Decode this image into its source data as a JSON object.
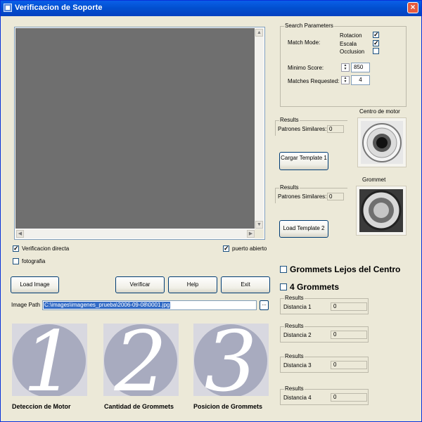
{
  "window": {
    "title": "Verificacion de Soporte",
    "close_glyph": "×"
  },
  "options": {
    "verificacion_directa": {
      "label": "Verificacion directa",
      "checked": true
    },
    "puerto_abierto": {
      "label": "puerto abierto",
      "checked": true
    },
    "fotografia": {
      "label": "fotografia",
      "checked": false
    }
  },
  "buttons": {
    "load_image": "Load Image",
    "verificar": "Verificar",
    "help": "Help",
    "exit": "Exit",
    "browse": "..."
  },
  "image_path": {
    "label": "Image Path",
    "value": "C:\\images\\imagenes_prueba\\2006-09-08\\0001.jpg"
  },
  "search_parameters": {
    "title": "Search Parameters",
    "match_mode_label": "Match Mode:",
    "rotacion": {
      "label": "Rotacion",
      "checked": true
    },
    "escala": {
      "label": "Escala",
      "checked": true
    },
    "occlusion": {
      "label": "Occlusion",
      "checked": false
    },
    "minimo_score_label": "Minimo Score:",
    "minimo_score_value": "850",
    "matches_requested_label": "Matches Requested:",
    "matches_requested_value": "4"
  },
  "template1": {
    "results_title": "Results",
    "patrones_label": "Patrones Similares:",
    "patrones_value": "0",
    "image_caption": "Centro de motor",
    "load_button": "Cargar Template 1"
  },
  "template2": {
    "results_title": "Results",
    "patrones_label": "Patrones Similares:",
    "patrones_value": "0",
    "image_caption": "Grommet",
    "load_button": "Load Template 2"
  },
  "grommet_options": {
    "lejos_del_centro": {
      "label": "Grommets Lejos del Centro",
      "checked": false
    },
    "cuatro_grommets": {
      "label": "4 Grommets",
      "checked": false
    }
  },
  "distances": [
    {
      "title": "Results",
      "label": "Distancia 1",
      "value": "0"
    },
    {
      "title": "Results",
      "label": "Distancia 2",
      "value": "0"
    },
    {
      "title": "Results",
      "label": "Distancia 3",
      "value": "0"
    },
    {
      "title": "Results",
      "label": "Distancia 4",
      "value": "0"
    }
  ],
  "steps": [
    {
      "number": "1",
      "label": "Deteccion de Motor"
    },
    {
      "number": "2",
      "label": "Cantidad de Grommets"
    },
    {
      "number": "3",
      "label": "Posicion de Grommets"
    }
  ],
  "colors": {
    "title_bar": "#0250d0",
    "selection": "#316ac5",
    "step_circle": "#a8abbf"
  }
}
